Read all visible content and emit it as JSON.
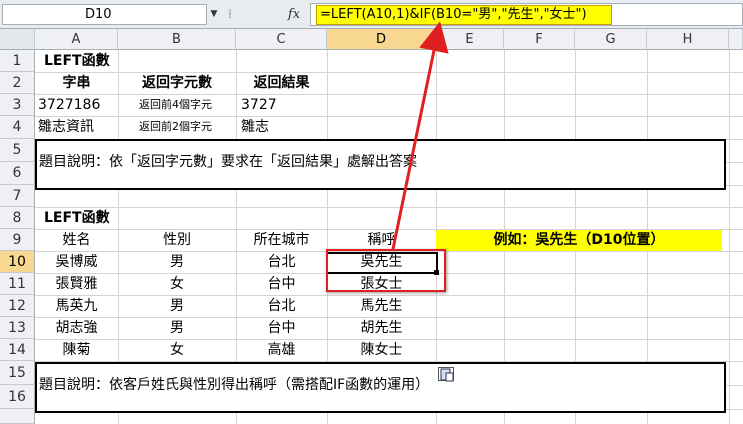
{
  "formula_bar": {
    "name_box": "D10",
    "dropdown": "▼",
    "separator": "⁞",
    "fx": "fx",
    "formula": "=LEFT(A10,1)&IF(B10=\"男\",\"先生\",\"女士\")"
  },
  "columns": [
    "A",
    "B",
    "C",
    "D",
    "E",
    "F",
    "G",
    "H"
  ],
  "selected_column": "D",
  "rows": [
    "1",
    "2",
    "3",
    "4",
    "5",
    "6",
    "7",
    "8",
    "9",
    "10",
    "11",
    "12",
    "13",
    "14",
    "15",
    "16"
  ],
  "selected_row": "10",
  "section1": {
    "title": "LEFT函數",
    "headers": [
      "字串",
      "返回字元數",
      "返回結果"
    ],
    "rows": [
      {
        "string": "3727186",
        "count": "返回前4個字元",
        "result": "3727"
      },
      {
        "string": "雛志資訊",
        "count": "返回前2個字元",
        "result": "雛志"
      }
    ],
    "description": "題目說明：依「返回字元數」要求在「返回結果」處解出答案"
  },
  "section2": {
    "title": "LEFT函數",
    "headers": [
      "姓名",
      "性別",
      "所在城市",
      "稱呼"
    ],
    "example": "例如：吳先生（D10位置）",
    "rows": [
      {
        "name": "吳博威",
        "gender": "男",
        "city": "台北",
        "title": "吳先生"
      },
      {
        "name": "張賢雅",
        "gender": "女",
        "city": "台中",
        "title": "張女士"
      },
      {
        "name": "馬英九",
        "gender": "男",
        "city": "台北",
        "title": "馬先生"
      },
      {
        "name": "胡志強",
        "gender": "男",
        "city": "台中",
        "title": "胡先生"
      },
      {
        "name": "陳菊",
        "gender": "女",
        "city": "高雄",
        "title": "陳女士"
      }
    ],
    "description": "題目說明：依客戶姓氏與性別得出稱呼（需搭配IF函數的運用）"
  },
  "colors": {
    "highlight": "#ffff00",
    "annotation_red": "#e02020",
    "selected_header": "#f8d890"
  }
}
